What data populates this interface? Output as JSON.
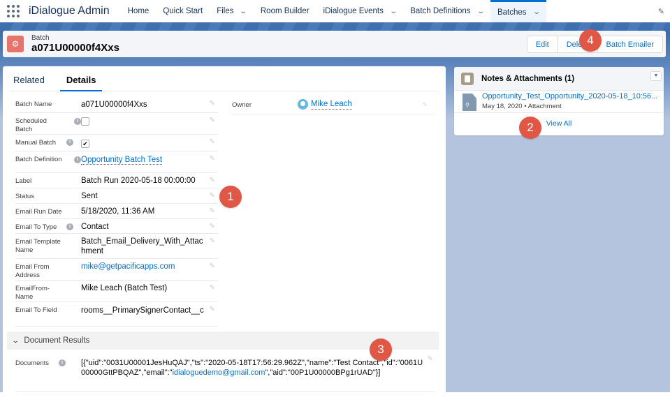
{
  "nav": {
    "app_name": "iDialogue Admin",
    "items": [
      {
        "label": "Home",
        "has_menu": false
      },
      {
        "label": "Quick Start",
        "has_menu": false
      },
      {
        "label": "Files",
        "has_menu": true
      },
      {
        "label": "Room Builder",
        "has_menu": false
      },
      {
        "label": "iDialogue Events",
        "has_menu": true
      },
      {
        "label": "Batch Definitions",
        "has_menu": true
      },
      {
        "label": "Batches",
        "has_menu": true,
        "active": true
      }
    ],
    "chevron": "⌄",
    "edit_icon": "✎"
  },
  "header": {
    "object_type": "Batch",
    "record_name": "a071U00000f4Xxs",
    "object_icon": "⚙",
    "actions": {
      "edit": "Edit",
      "delete": "Delete",
      "batch_emailer": "Batch Emailer"
    }
  },
  "tabs": {
    "related": "Related",
    "details": "Details"
  },
  "fields": [
    {
      "label": "Batch Name",
      "value": "a071U00000f4Xxs"
    },
    {
      "label": "Scheduled Batch",
      "value": "",
      "checkbox": false,
      "info": true
    },
    {
      "label": "Manual Batch",
      "value": "",
      "checkbox": true,
      "info": true
    },
    {
      "label": "Batch Definition",
      "value": "Opportunity Batch Test",
      "link": true,
      "info": true
    },
    {
      "label": "Label",
      "value": "Batch Run 2020-05-18 00:00:00"
    },
    {
      "label": "Status",
      "value": "Sent"
    },
    {
      "label": "Email Run Date",
      "value": "5/18/2020, 11:36 AM"
    },
    {
      "label": "Email To Type",
      "value": "Contact",
      "info": true
    },
    {
      "label": "Email Template Name",
      "value": "Batch_Email_Delivery_With_Attachment"
    },
    {
      "label": "Email From Address",
      "value": "mike@getpacificapps.com",
      "link": true
    },
    {
      "label": "EmailFrom-Name",
      "value": "Mike Leach (Batch Test)"
    },
    {
      "label": "Email To Field",
      "value": "rooms__PrimarySignerContact__c"
    }
  ],
  "owner": {
    "label": "Owner",
    "value": "Mike Leach"
  },
  "document_results": {
    "section_title": "Document Results",
    "label": "Documents",
    "value_before_email": "[{\"uid\":\"0031U00001JesHuQAJ\",\"ts\":\"2020-05-18T17:56:29.962Z\",\"name\":\"Test Contact\",\"id\":\"0061U00000GttPBQAZ\",\"email\":\"",
    "email": "idialoguedemo@gmail.com",
    "value_after_email": "\",\"aid\":\"00P1U00000BPg1rUAD\"}]"
  },
  "notes_attachments": {
    "title": "Notes & Attachments (1)",
    "items": [
      {
        "name": "Opportunity_Test_Opportunity_2020-05-18_10:56...",
        "meta": "May 18, 2020 • Attachment"
      }
    ],
    "view_all": "View All"
  },
  "annotations": [
    "1",
    "2",
    "3",
    "4"
  ],
  "colors": {
    "brand_blue": "#0070d2",
    "object_icon": "#e8736b",
    "annotation_red": "#e05745",
    "banner_blue": "#3b6aa8"
  }
}
